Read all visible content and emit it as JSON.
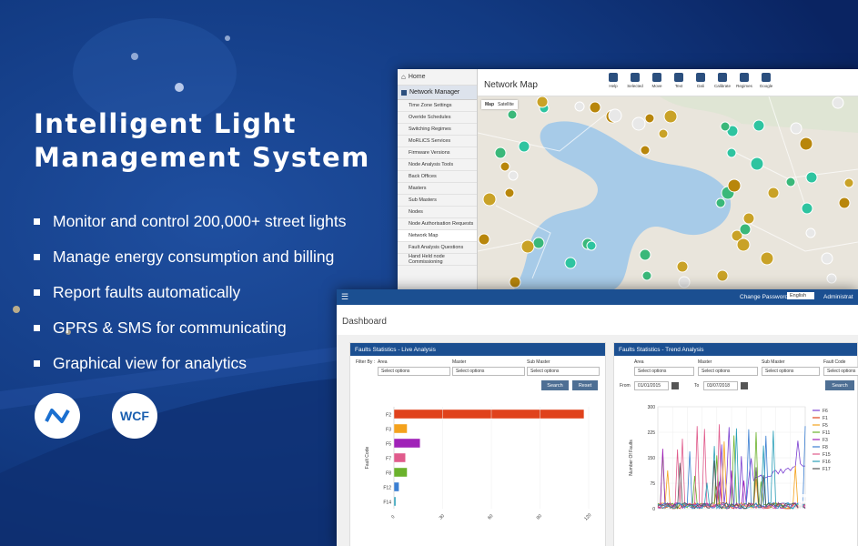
{
  "hero": {
    "title": "Intelligent Light\nManagement System",
    "features": [
      "Monitor and control 200,000+ street lights",
      "Manage energy consumption and billing",
      "Report faults automatically",
      "GPRS & SMS for communicating",
      "Graphical view for analytics"
    ],
    "logos": [
      "dotnet-logo",
      "WCF"
    ]
  },
  "network_window": {
    "home": "Home",
    "section": "Network Manager",
    "menu": [
      "Time Zone Settings",
      "Overide Schedules",
      "Switching Regimes",
      "MoRLiCS Services",
      "Firmware Versions",
      "Node Analysis Tools",
      "Back Offices",
      "Masters",
      "Sub Masters",
      "Nodes",
      "Node Authorisation Requests",
      "Network Map",
      "Fault Analysis Questions",
      "Hand Held node Commissioning"
    ],
    "active_item": "Network Map",
    "title": "Network Map",
    "toolbar": [
      "Help",
      "Selected",
      "Move",
      "Text",
      "Dali",
      "Calibrate",
      "Regimes",
      "Google"
    ],
    "map_tabs": [
      "Map",
      "Satellite"
    ]
  },
  "dashboard_window": {
    "change_password": "Change Password",
    "language": "English",
    "user": "Administrat",
    "title": "Dashboard",
    "live_panel": {
      "title": "Faults Statistics - Live Analysis",
      "filter_label": "Filter By :",
      "filters": [
        "Area",
        "Master",
        "Sub Master"
      ],
      "placeholder": "Select options",
      "search": "Search",
      "reset": "Reset"
    },
    "trend_panel": {
      "title": "Faults Statistics - Trend Analysis",
      "filters": [
        "Area",
        "Master",
        "Sub Master",
        "Fault Code"
      ],
      "placeholder": "Select options",
      "from_label": "From",
      "from_value": "01/01/2015",
      "to_label": "To",
      "to_value": "03/07/2018",
      "search": "Search"
    }
  },
  "chart_data": [
    {
      "type": "bar",
      "orientation": "horizontal",
      "categories": [
        "F2",
        "F3",
        "F5",
        "F7",
        "F8",
        "F12",
        "F14"
      ],
      "values": [
        117,
        8,
        16,
        7,
        8,
        3,
        1
      ],
      "xlim": [
        0,
        120
      ],
      "xticks": [
        "0",
        "30",
        "60",
        "90",
        "120"
      ],
      "ylabel": "Fault Code",
      "colors": [
        "#e0421c",
        "#f4a21d",
        "#a022b8",
        "#e05b8c",
        "#6bb22c",
        "#3b7fd2",
        "#2a9fb8"
      ]
    },
    {
      "type": "line",
      "ylabel": "Number Of Faults",
      "ylim": [
        0,
        300
      ],
      "yticks": [
        "0",
        "75",
        "150",
        "225",
        "300"
      ],
      "legend": [
        "F6",
        "F1",
        "F5",
        "F11",
        "F3",
        "F8",
        "F15",
        "F16",
        "F17"
      ],
      "legend_colors": [
        "#7a3fd1",
        "#e0421c",
        "#f4a21d",
        "#6bb22c",
        "#a022b8",
        "#3b7fd2",
        "#e05b8c",
        "#2a9fb8",
        "#555555"
      ]
    }
  ]
}
